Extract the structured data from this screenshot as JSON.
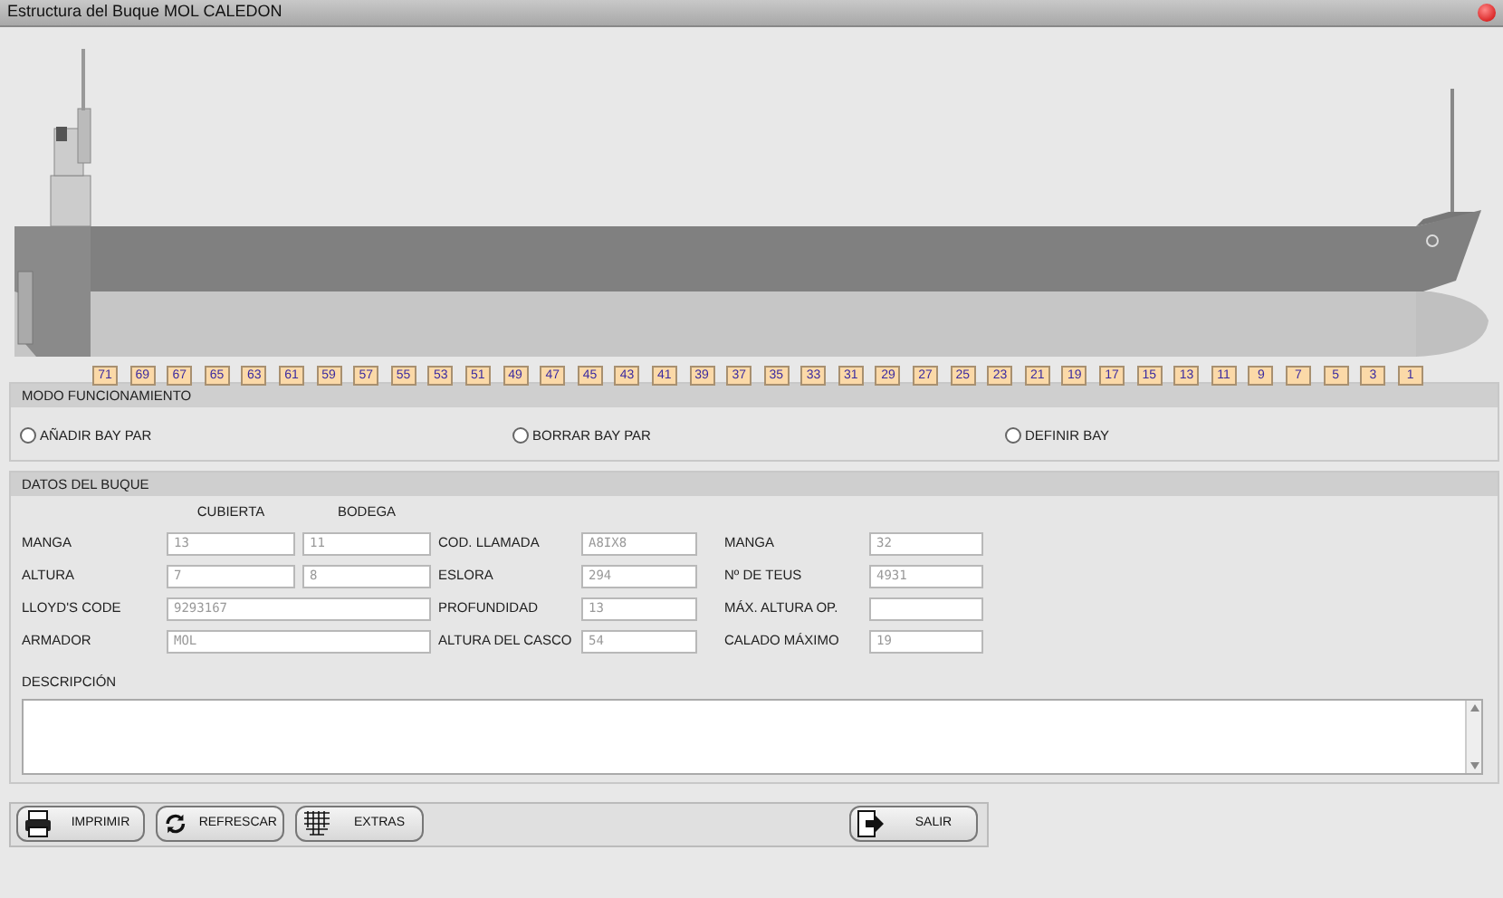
{
  "window": {
    "title": "Estructura del Buque MOL CALEDON"
  },
  "bays": [
    "71",
    "69",
    "67",
    "65",
    "63",
    "61",
    "59",
    "57",
    "55",
    "53",
    "51",
    "49",
    "47",
    "45",
    "43",
    "41",
    "39",
    "37",
    "35",
    "33",
    "31",
    "29",
    "27",
    "25",
    "23",
    "21",
    "19",
    "17",
    "15",
    "13",
    "11",
    "9",
    "7",
    "5",
    "3",
    "1"
  ],
  "mode": {
    "title": "MODO FUNCIONAMIENTO",
    "options": [
      {
        "label": "AÑADIR BAY PAR",
        "selected": false
      },
      {
        "label": "BORRAR BAY PAR",
        "selected": false
      },
      {
        "label": "DEFINIR BAY",
        "selected": false
      }
    ]
  },
  "ship_data": {
    "title": "DATOS DEL BUQUE",
    "column_headers": [
      "CUBIERTA",
      "BODEGA"
    ],
    "left": [
      {
        "label": "MANGA",
        "values": [
          "13",
          "11"
        ]
      },
      {
        "label": "ALTURA",
        "values": [
          "7",
          "8"
        ]
      },
      {
        "label": "LLOYD'S CODE",
        "values": [
          "9293167"
        ]
      },
      {
        "label": "ARMADOR",
        "values": [
          "MOL"
        ]
      }
    ],
    "middle": [
      {
        "label": "COD. LLAMADA",
        "value": "A8IX8"
      },
      {
        "label": "ESLORA",
        "value": "294"
      },
      {
        "label": "PROFUNDIDAD",
        "value": "13"
      },
      {
        "label": "ALTURA DEL CASCO",
        "value": "54"
      }
    ],
    "right": [
      {
        "label": "MANGA",
        "value": "32"
      },
      {
        "label": "Nº DE TEUS",
        "value": "4931"
      },
      {
        "label": "MÁX. ALTURA OP."
      },
      {
        "label": "CALADO MÁXIMO",
        "value": "19"
      }
    ],
    "description": {
      "label": "DESCRIPCIÓN"
    }
  },
  "buttons": [
    {
      "kind": "print",
      "label": "IMPRIMIR"
    },
    {
      "kind": "refresh",
      "label": "REFRESCAR"
    },
    {
      "kind": "grid",
      "label": "EXTRAS"
    },
    {
      "kind": "exit",
      "label": "SALIR"
    }
  ]
}
